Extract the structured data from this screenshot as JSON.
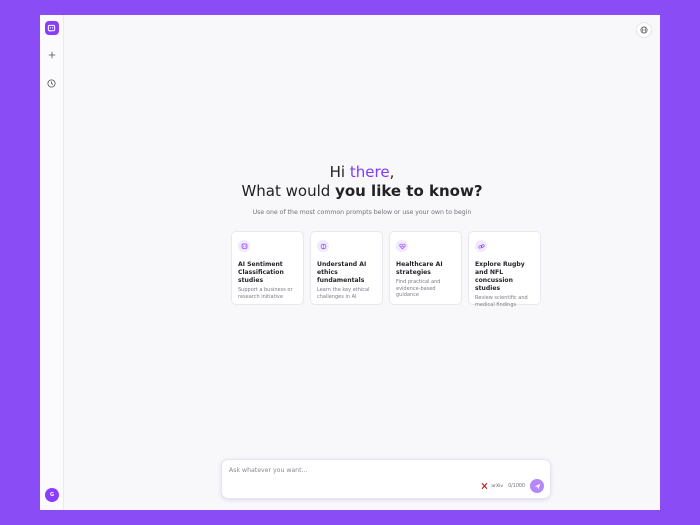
{
  "app": {
    "sidebar": {
      "new_chat_icon": "plus-icon",
      "history_icon": "clock-icon",
      "avatar_initial": "G"
    },
    "header": {
      "language_icon": "globe-icon"
    },
    "hero": {
      "greeting_prefix": "Hi ",
      "greeting_name": "there",
      "greeting_suffix": ",",
      "question_prefix": "What would ",
      "question_strong": "you like to know?",
      "subtitle": "Use one of the most common prompts below or use your own to begin"
    },
    "cards": [
      {
        "icon": "chat-bot-icon",
        "title": "AI Sentiment Classification studies",
        "desc": "Support a business or research initiative"
      },
      {
        "icon": "brain-icon",
        "title": "Understand AI ethics fundamentals",
        "desc": "Learn the key ethical challenges in AI"
      },
      {
        "icon": "heart-pulse-icon",
        "title": "Healthcare AI strategies",
        "desc": "Find practical and evidence-based guidance"
      },
      {
        "icon": "link-icon",
        "title": "Explore Rugby and NFL concussion studies",
        "desc": "Review scientific and medical findings"
      }
    ],
    "composer": {
      "placeholder": "Ask whatever you want...",
      "source_label": "arXiv",
      "counter": "0/1000"
    },
    "colors": {
      "accent": "#8b3dff",
      "background": "#8a4cf5",
      "send": "#b388ff"
    }
  }
}
